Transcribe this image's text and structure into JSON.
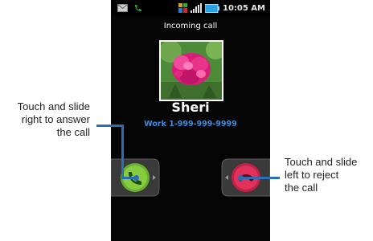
{
  "status_bar": {
    "time": "10:05 AM",
    "icons": [
      "message-icon",
      "missed-call-icon",
      "sim-icon",
      "signal-bars-icon",
      "battery-icon"
    ]
  },
  "call": {
    "title": "Incoming call",
    "caller_name": "Sheri",
    "caller_number": "Work 1-999-999-9999"
  },
  "controls": {
    "answer_icon": "phone-answer-icon",
    "reject_icon": "phone-reject-icon",
    "answer_color": "#7bc23a",
    "reject_color": "#e2315a"
  },
  "callouts": {
    "answer": [
      "Touch and slide",
      "right to answer",
      "the call"
    ],
    "reject": [
      "Touch and slide",
      "left to reject",
      "the call"
    ]
  },
  "colors": {
    "accent": "#2a6fb6",
    "number": "#3b8fe0"
  }
}
